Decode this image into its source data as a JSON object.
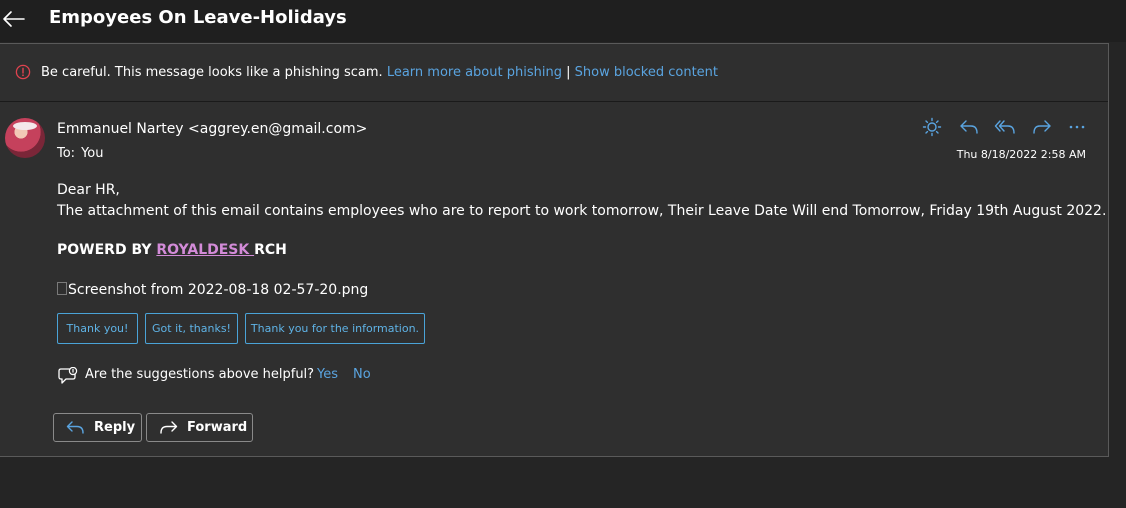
{
  "header": {
    "subject": "Empoyees On Leave-Holidays"
  },
  "warning": {
    "message": "Be careful. This message looks like a phishing scam.",
    "learn_more": "Learn more about phishing",
    "separator": "|",
    "show_blocked": "Show blocked content"
  },
  "message": {
    "sender": "Emmanuel Nartey <aggrey.en@gmail.com>",
    "to_label": "To:",
    "to_value": "You",
    "date": "Thu 8/18/2022 2:58 AM",
    "body": {
      "greeting": "Dear HR,",
      "line1": "The attachment of this email contains employees who are to report to work tomorrow, Their Leave Date Will end Tomorrow, Friday 19th August  2022.",
      "powered_prefix": "POWERD BY ",
      "powered_link": "ROYALDESK ",
      "powered_suffix": "RCH"
    },
    "attachment": "Screenshot from 2022-08-18 02-57-20.png"
  },
  "suggestions": [
    "Thank you!",
    "Got it, thanks!",
    "Thank you for the information."
  ],
  "feedback": {
    "question": "Are the suggestions above helpful?",
    "yes": "Yes",
    "no": "No"
  },
  "buttons": {
    "reply": "Reply",
    "forward": "Forward"
  },
  "colors": {
    "accent": "#5aa4e0",
    "warning": "#e0434f",
    "royal_link": "#d38bd8"
  }
}
